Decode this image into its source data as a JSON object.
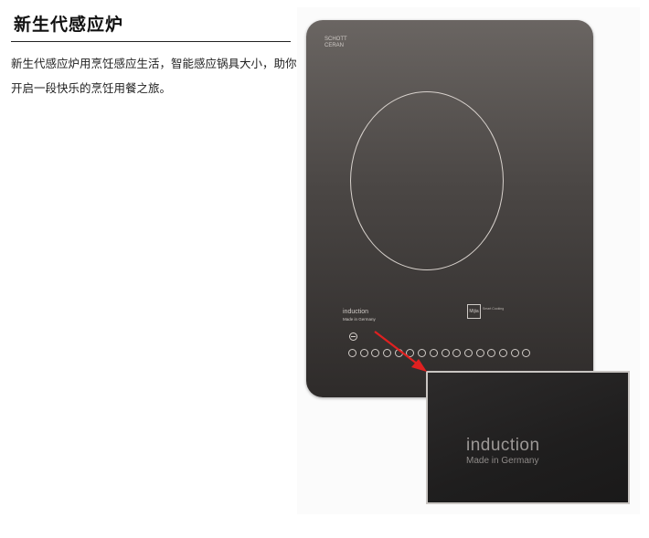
{
  "heading": "新生代感应炉",
  "description": "新生代感应炉用烹饪感应生活，智能感应锅具大小，助你开启一段快乐的烹饪用餐之旅。",
  "cooktop": {
    "brand_line1": "SCHOTT",
    "brand_line2": "CERAN",
    "panel_title": "induction",
    "panel_subtitle": "Made in Germany",
    "badge": "Mijia",
    "badge_text": "Smart Cooking"
  },
  "inset": {
    "title": "induction",
    "subtitle": "Made in Germany"
  },
  "colors": {
    "arrow": "#e02020",
    "cooktop_top": "#6a6562",
    "cooktop_bottom": "#2e2b2a"
  }
}
